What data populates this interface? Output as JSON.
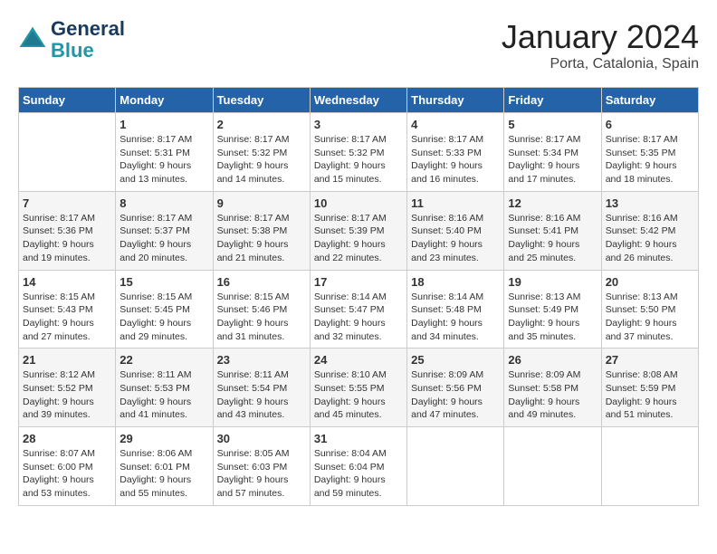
{
  "header": {
    "logo_line1": "General",
    "logo_line2": "Blue",
    "title": "January 2024",
    "subtitle": "Porta, Catalonia, Spain"
  },
  "days_of_week": [
    "Sunday",
    "Monday",
    "Tuesday",
    "Wednesday",
    "Thursday",
    "Friday",
    "Saturday"
  ],
  "weeks": [
    [
      {
        "day": "",
        "info": ""
      },
      {
        "day": "1",
        "info": "Sunrise: 8:17 AM\nSunset: 5:31 PM\nDaylight: 9 hours\nand 13 minutes."
      },
      {
        "day": "2",
        "info": "Sunrise: 8:17 AM\nSunset: 5:32 PM\nDaylight: 9 hours\nand 14 minutes."
      },
      {
        "day": "3",
        "info": "Sunrise: 8:17 AM\nSunset: 5:32 PM\nDaylight: 9 hours\nand 15 minutes."
      },
      {
        "day": "4",
        "info": "Sunrise: 8:17 AM\nSunset: 5:33 PM\nDaylight: 9 hours\nand 16 minutes."
      },
      {
        "day": "5",
        "info": "Sunrise: 8:17 AM\nSunset: 5:34 PM\nDaylight: 9 hours\nand 17 minutes."
      },
      {
        "day": "6",
        "info": "Sunrise: 8:17 AM\nSunset: 5:35 PM\nDaylight: 9 hours\nand 18 minutes."
      }
    ],
    [
      {
        "day": "7",
        "info": "Sunrise: 8:17 AM\nSunset: 5:36 PM\nDaylight: 9 hours\nand 19 minutes."
      },
      {
        "day": "8",
        "info": "Sunrise: 8:17 AM\nSunset: 5:37 PM\nDaylight: 9 hours\nand 20 minutes."
      },
      {
        "day": "9",
        "info": "Sunrise: 8:17 AM\nSunset: 5:38 PM\nDaylight: 9 hours\nand 21 minutes."
      },
      {
        "day": "10",
        "info": "Sunrise: 8:17 AM\nSunset: 5:39 PM\nDaylight: 9 hours\nand 22 minutes."
      },
      {
        "day": "11",
        "info": "Sunrise: 8:16 AM\nSunset: 5:40 PM\nDaylight: 9 hours\nand 23 minutes."
      },
      {
        "day": "12",
        "info": "Sunrise: 8:16 AM\nSunset: 5:41 PM\nDaylight: 9 hours\nand 25 minutes."
      },
      {
        "day": "13",
        "info": "Sunrise: 8:16 AM\nSunset: 5:42 PM\nDaylight: 9 hours\nand 26 minutes."
      }
    ],
    [
      {
        "day": "14",
        "info": "Sunrise: 8:15 AM\nSunset: 5:43 PM\nDaylight: 9 hours\nand 27 minutes."
      },
      {
        "day": "15",
        "info": "Sunrise: 8:15 AM\nSunset: 5:45 PM\nDaylight: 9 hours\nand 29 minutes."
      },
      {
        "day": "16",
        "info": "Sunrise: 8:15 AM\nSunset: 5:46 PM\nDaylight: 9 hours\nand 31 minutes."
      },
      {
        "day": "17",
        "info": "Sunrise: 8:14 AM\nSunset: 5:47 PM\nDaylight: 9 hours\nand 32 minutes."
      },
      {
        "day": "18",
        "info": "Sunrise: 8:14 AM\nSunset: 5:48 PM\nDaylight: 9 hours\nand 34 minutes."
      },
      {
        "day": "19",
        "info": "Sunrise: 8:13 AM\nSunset: 5:49 PM\nDaylight: 9 hours\nand 35 minutes."
      },
      {
        "day": "20",
        "info": "Sunrise: 8:13 AM\nSunset: 5:50 PM\nDaylight: 9 hours\nand 37 minutes."
      }
    ],
    [
      {
        "day": "21",
        "info": "Sunrise: 8:12 AM\nSunset: 5:52 PM\nDaylight: 9 hours\nand 39 minutes."
      },
      {
        "day": "22",
        "info": "Sunrise: 8:11 AM\nSunset: 5:53 PM\nDaylight: 9 hours\nand 41 minutes."
      },
      {
        "day": "23",
        "info": "Sunrise: 8:11 AM\nSunset: 5:54 PM\nDaylight: 9 hours\nand 43 minutes."
      },
      {
        "day": "24",
        "info": "Sunrise: 8:10 AM\nSunset: 5:55 PM\nDaylight: 9 hours\nand 45 minutes."
      },
      {
        "day": "25",
        "info": "Sunrise: 8:09 AM\nSunset: 5:56 PM\nDaylight: 9 hours\nand 47 minutes."
      },
      {
        "day": "26",
        "info": "Sunrise: 8:09 AM\nSunset: 5:58 PM\nDaylight: 9 hours\nand 49 minutes."
      },
      {
        "day": "27",
        "info": "Sunrise: 8:08 AM\nSunset: 5:59 PM\nDaylight: 9 hours\nand 51 minutes."
      }
    ],
    [
      {
        "day": "28",
        "info": "Sunrise: 8:07 AM\nSunset: 6:00 PM\nDaylight: 9 hours\nand 53 minutes."
      },
      {
        "day": "29",
        "info": "Sunrise: 8:06 AM\nSunset: 6:01 PM\nDaylight: 9 hours\nand 55 minutes."
      },
      {
        "day": "30",
        "info": "Sunrise: 8:05 AM\nSunset: 6:03 PM\nDaylight: 9 hours\nand 57 minutes."
      },
      {
        "day": "31",
        "info": "Sunrise: 8:04 AM\nSunset: 6:04 PM\nDaylight: 9 hours\nand 59 minutes."
      },
      {
        "day": "",
        "info": ""
      },
      {
        "day": "",
        "info": ""
      },
      {
        "day": "",
        "info": ""
      }
    ]
  ]
}
